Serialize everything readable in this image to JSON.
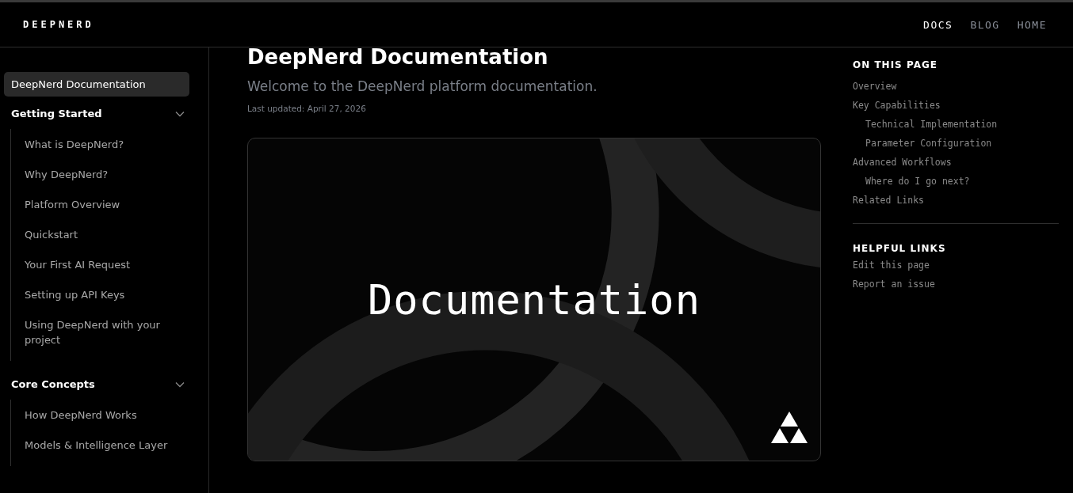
{
  "header": {
    "logo": "DEEPNERD",
    "nav": [
      {
        "label": "DOCS",
        "selected": true
      },
      {
        "label": "BLOG",
        "selected": false
      },
      {
        "label": "HOME",
        "selected": false
      }
    ]
  },
  "sidebar": {
    "items": [
      {
        "kind": "link",
        "label": "DeepNerd Documentation",
        "selected": true
      },
      {
        "kind": "group",
        "label": "Getting Started",
        "expanded": true,
        "children": [
          {
            "label": "What is DeepNerd?"
          },
          {
            "label": "Why DeepNerd?"
          },
          {
            "label": "Platform Overview"
          },
          {
            "label": "Quickstart"
          },
          {
            "label": "Your First AI Request"
          },
          {
            "label": "Setting up API Keys"
          },
          {
            "label": "Using DeepNerd with your project"
          }
        ]
      },
      {
        "kind": "group",
        "label": "Core Concepts",
        "expanded": true,
        "children": [
          {
            "label": "How DeepNerd Works"
          },
          {
            "label": "Models & Intelligence Layer"
          }
        ]
      }
    ]
  },
  "main": {
    "title": "DeepNerd Documentation",
    "subtitle": "Welcome to the DeepNerd platform documentation.",
    "updated": "Last updated: April 27, 2026",
    "hero": {
      "text": "Documentation"
    }
  },
  "toc": {
    "heading": "ON THIS PAGE",
    "items": [
      {
        "label": "Overview"
      },
      {
        "label": "Key Capabilities",
        "children": [
          {
            "label": "Technical Implementation"
          },
          {
            "label": "Parameter Configuration"
          }
        ]
      },
      {
        "label": "Advanced Workflows",
        "children": [
          {
            "label": "Where do I go next?"
          }
        ]
      },
      {
        "label": "Related Links"
      }
    ]
  },
  "helpful": {
    "heading": "HELPFUL LINKS",
    "items": [
      "Edit this page",
      "Report an issue"
    ]
  }
}
